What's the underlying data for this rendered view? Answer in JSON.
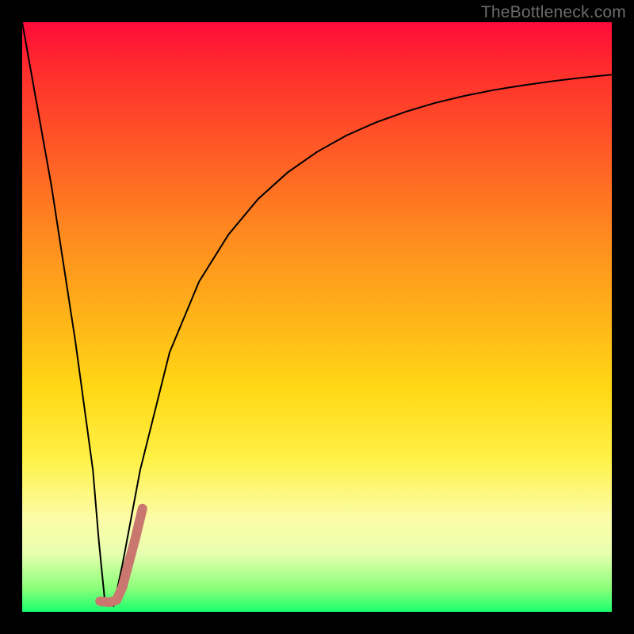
{
  "attribution": "TheBottleneck.com",
  "chart_data": {
    "type": "line",
    "title": "",
    "xlabel": "",
    "ylabel": "",
    "xlim": [
      0,
      100
    ],
    "ylim": [
      0,
      100
    ],
    "grid": false,
    "legend": false,
    "series": [
      {
        "name": "bottleneck-curve",
        "color": "#000000",
        "stroke_width": 2,
        "x": [
          0,
          5,
          9,
          12,
          13,
          14,
          15.5,
          17,
          20,
          25,
          30,
          35,
          40,
          45,
          50,
          55,
          60,
          65,
          70,
          75,
          80,
          85,
          90,
          95,
          100
        ],
        "values": [
          100,
          72,
          46,
          24,
          12,
          2,
          1,
          8,
          24,
          44,
          56,
          64,
          70,
          74.5,
          78,
          80.8,
          83,
          84.8,
          86.3,
          87.5,
          88.5,
          89.3,
          90,
          90.6,
          91.1
        ]
      },
      {
        "name": "highlight-segment",
        "color": "#c9776f",
        "stroke_width": 12,
        "linecap": "round",
        "x": [
          13.2,
          14.8,
          16.0,
          17.0,
          18.0,
          19.2,
          20.4
        ],
        "values": [
          1.8,
          1.6,
          2.0,
          4.2,
          8.0,
          12.5,
          17.5
        ]
      }
    ]
  }
}
